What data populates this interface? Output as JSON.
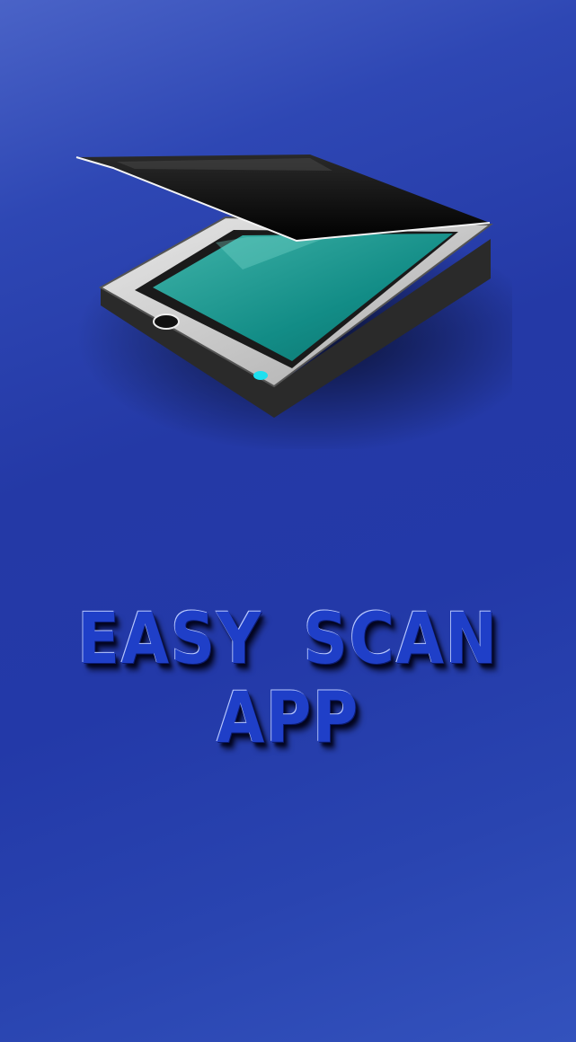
{
  "splash": {
    "title_line1": "EASY SCAN",
    "title_line2": "APP",
    "logo_icon": "scanner-icon"
  },
  "colors": {
    "background_start": "#4a63c7",
    "background_mid": "#2439a6",
    "background_end": "#3352bd",
    "title_color": "#1f3fc8",
    "scanner_glass": "#128c86",
    "scanner_body": "#c8c8c8",
    "scanner_lid": "#050505",
    "indicator_light": "#1fe0f0"
  }
}
